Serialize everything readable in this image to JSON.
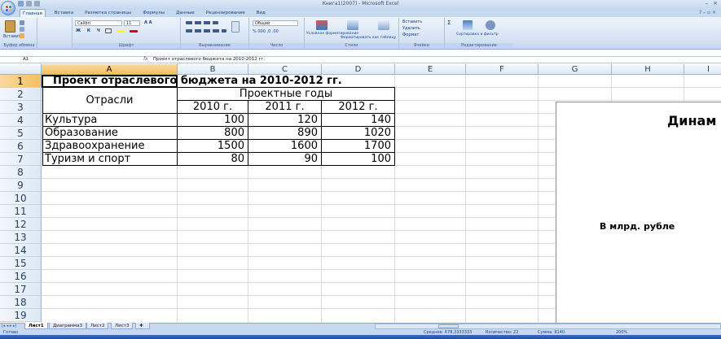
{
  "window": {
    "title": "Книга1(2007) - Microsoft Excel"
  },
  "ribbon": {
    "tabs": [
      "Главная",
      "Вставка",
      "Разметка страницы",
      "Формулы",
      "Данные",
      "Рецензирование",
      "Вид"
    ],
    "active_tab": "Главная",
    "clipboard": {
      "paste": "Вставить",
      "group": "Буфер обмена"
    },
    "font": {
      "name": "Calibri",
      "size": "11",
      "group": "Шрифт"
    },
    "alignment": {
      "group": "Выравнивание"
    },
    "number": {
      "format": "Общий",
      "group": "Число"
    },
    "styles": {
      "conditional": "Условное форматирование",
      "as_table": "Форматировать как таблицу",
      "cell_styles": "Стили ячеек",
      "group": "Стили"
    },
    "cells": {
      "insert": "Вставить",
      "delete": "Удалить",
      "format": "Формат",
      "group": "Ячейки"
    },
    "editing": {
      "sort": "Сортировка и фильтр",
      "find": "Найти и выделить",
      "group": "Редактирование"
    }
  },
  "formula_bar": {
    "name_box": "A1",
    "formula": "Проект отраслевого бюджета на 2010-2012 гг."
  },
  "columns": [
    "A",
    "B",
    "C",
    "D",
    "E",
    "F",
    "G",
    "H",
    "I"
  ],
  "rows": [
    "1",
    "2",
    "3",
    "4",
    "5",
    "6",
    "7",
    "8",
    "9",
    "10",
    "11",
    "12",
    "13",
    "14",
    "15",
    "16",
    "17",
    "18",
    "19"
  ],
  "table": {
    "title": "Проект отраслевого бюджета на 2010-2012 гг.",
    "header_sector": "Отрасли",
    "header_years": "Проектные годы",
    "years": [
      "2010 г.",
      "2011 г.",
      "2012 г."
    ],
    "rows": [
      {
        "name": "Культура",
        "v": [
          "100",
          "120",
          "140"
        ]
      },
      {
        "name": "Образование",
        "v": [
          "800",
          "890",
          "1020"
        ]
      },
      {
        "name": "Здравоохранение",
        "v": [
          "1500",
          "1600",
          "1700"
        ]
      },
      {
        "name": "Туризм и спорт",
        "v": [
          "80",
          "90",
          "100"
        ]
      }
    ]
  },
  "chart": {
    "title_partial": "Динам",
    "axis_label_partial": "В млрд. рубле"
  },
  "sheets": [
    "Лист1",
    "Диаграмма3",
    "Лист2",
    "Лист3"
  ],
  "active_sheet": "Лист1",
  "status": {
    "ready": "Готово",
    "average": "Среднее: 678,3333333",
    "count": "Количество: 22",
    "sum": "Сумма: 8140",
    "zoom": "200%"
  }
}
